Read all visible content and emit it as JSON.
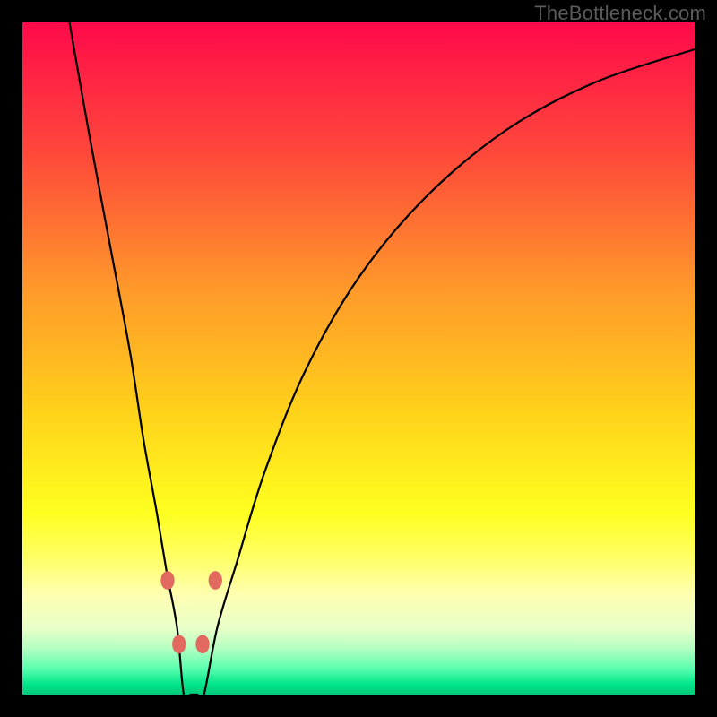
{
  "attribution": "TheBottleneck.com",
  "chart_data": {
    "type": "line",
    "title": "",
    "xlabel": "",
    "ylabel": "",
    "xlim": [
      0,
      100
    ],
    "ylim": [
      0,
      100
    ],
    "grid": false,
    "legend": false,
    "gradient_stops": [
      {
        "pos": 0.0,
        "color": "#ff0a4a"
      },
      {
        "pos": 0.2,
        "color": "#ff4a3a"
      },
      {
        "pos": 0.4,
        "color": "#ff9a2a"
      },
      {
        "pos": 0.58,
        "color": "#ffd21a"
      },
      {
        "pos": 0.73,
        "color": "#ffff20"
      },
      {
        "pos": 0.8,
        "color": "#ffff6a"
      },
      {
        "pos": 0.85,
        "color": "#ffffb0"
      },
      {
        "pos": 0.9,
        "color": "#e9ffc8"
      },
      {
        "pos": 0.93,
        "color": "#b7ffc2"
      },
      {
        "pos": 0.96,
        "color": "#5fffb0"
      },
      {
        "pos": 0.985,
        "color": "#00e58a"
      },
      {
        "pos": 1.0,
        "color": "#00c87a"
      }
    ],
    "series": [
      {
        "name": "bottleneck-curve",
        "x": [
          7,
          10,
          13,
          16,
          18,
          20,
          21.5,
          23,
          24,
          25,
          26,
          27,
          29,
          32,
          36,
          42,
          50,
          60,
          72,
          85,
          100
        ],
        "values": [
          100,
          83,
          67,
          51,
          38,
          27,
          18,
          10,
          4.5,
          1.5,
          1.5,
          4,
          10,
          20,
          33,
          48,
          62,
          74,
          84,
          91,
          96
        ]
      }
    ],
    "markers": {
      "name": "threshold-dots",
      "color": "#e2695f",
      "radius_frac": 0.012,
      "points": [
        {
          "x": 21.6,
          "y": 17.0
        },
        {
          "x": 23.3,
          "y": 7.5
        },
        {
          "x": 26.8,
          "y": 7.5
        },
        {
          "x": 28.7,
          "y": 17.0
        }
      ]
    },
    "zero_band": {
      "from": 23.5,
      "to": 27.0
    }
  }
}
